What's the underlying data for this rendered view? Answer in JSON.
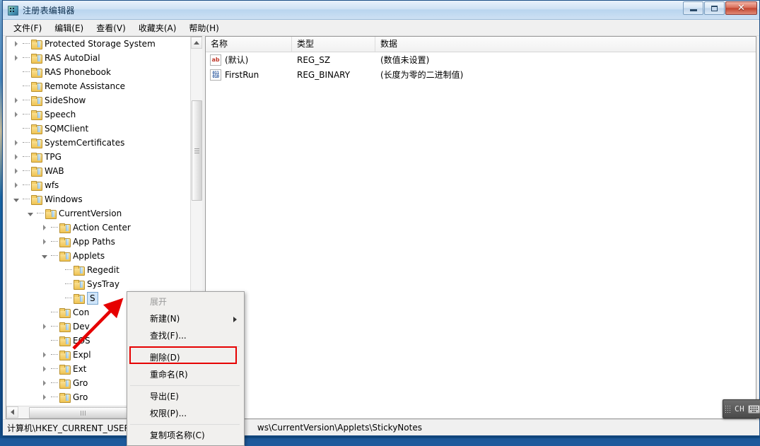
{
  "window": {
    "title": "注册表编辑器",
    "app_icon": "registry-editor-icon",
    "controls": {
      "minimize": "最小化",
      "maximize": "最大化",
      "close": "关闭"
    }
  },
  "menubar": [
    {
      "label": "文件(F)",
      "key": "F"
    },
    {
      "label": "编辑(E)",
      "key": "E"
    },
    {
      "label": "查看(V)",
      "key": "V"
    },
    {
      "label": "收藏夹(A)",
      "key": "A"
    },
    {
      "label": "帮助(H)",
      "key": "H"
    }
  ],
  "tree": [
    {
      "label": "Protected Storage System",
      "indent": 4,
      "expandable": true,
      "expanded": false,
      "selected": false,
      "clipped": true
    },
    {
      "label": "RAS AutoDial",
      "indent": 4,
      "expandable": true,
      "expanded": false,
      "selected": false
    },
    {
      "label": "RAS Phonebook",
      "indent": 4,
      "expandable": false,
      "expanded": false,
      "selected": false
    },
    {
      "label": "Remote Assistance",
      "indent": 4,
      "expandable": false,
      "expanded": false,
      "selected": false
    },
    {
      "label": "SideShow",
      "indent": 4,
      "expandable": true,
      "expanded": false,
      "selected": false
    },
    {
      "label": "Speech",
      "indent": 4,
      "expandable": true,
      "expanded": false,
      "selected": false
    },
    {
      "label": "SQMClient",
      "indent": 4,
      "expandable": false,
      "expanded": false,
      "selected": false
    },
    {
      "label": "SystemCertificates",
      "indent": 4,
      "expandable": true,
      "expanded": false,
      "selected": false
    },
    {
      "label": "TPG",
      "indent": 4,
      "expandable": true,
      "expanded": false,
      "selected": false
    },
    {
      "label": "WAB",
      "indent": 4,
      "expandable": true,
      "expanded": false,
      "selected": false
    },
    {
      "label": "wfs",
      "indent": 4,
      "expandable": true,
      "expanded": false,
      "selected": false
    },
    {
      "label": "Windows",
      "indent": 4,
      "expandable": true,
      "expanded": true,
      "selected": false
    },
    {
      "label": "CurrentVersion",
      "indent": 5,
      "expandable": true,
      "expanded": true,
      "selected": false
    },
    {
      "label": "Action Center",
      "indent": 6,
      "expandable": true,
      "expanded": false,
      "selected": false
    },
    {
      "label": "App Paths",
      "indent": 6,
      "expandable": true,
      "expanded": false,
      "selected": false
    },
    {
      "label": "Applets",
      "indent": 6,
      "expandable": true,
      "expanded": true,
      "selected": false
    },
    {
      "label": "Regedit",
      "indent": 7,
      "expandable": false,
      "expanded": false,
      "selected": false
    },
    {
      "label": "SysTray",
      "indent": 7,
      "expandable": false,
      "expanded": false,
      "selected": false
    },
    {
      "label": "S",
      "indent": 7,
      "expandable": false,
      "expanded": false,
      "selected": true
    },
    {
      "label": "Con",
      "indent": 6,
      "expandable": false,
      "expanded": false,
      "selected": false
    },
    {
      "label": "Dev",
      "indent": 6,
      "expandable": true,
      "expanded": false,
      "selected": false
    },
    {
      "label": "EOS",
      "indent": 6,
      "expandable": false,
      "expanded": false,
      "selected": false
    },
    {
      "label": "Expl",
      "indent": 6,
      "expandable": true,
      "expanded": false,
      "selected": false
    },
    {
      "label": "Ext",
      "indent": 6,
      "expandable": true,
      "expanded": false,
      "selected": false
    },
    {
      "label": "Gro",
      "indent": 6,
      "expandable": true,
      "expanded": false,
      "selected": false
    },
    {
      "label": "Gro",
      "indent": 6,
      "expandable": true,
      "expanded": false,
      "selected": false
    }
  ],
  "list": {
    "columns": [
      "名称",
      "类型",
      "数据"
    ],
    "rows": [
      {
        "icon": "string-value-icon",
        "name": "(默认)",
        "type": "REG_SZ",
        "data": "(数值未设置)"
      },
      {
        "icon": "binary-value-icon",
        "name": "FirstRun",
        "type": "REG_BINARY",
        "data": "(长度为零的二进制值)"
      }
    ]
  },
  "context_menu": {
    "items": [
      {
        "label": "展开",
        "disabled": true,
        "submenu": false,
        "separator_after": false
      },
      {
        "label": "新建(N)",
        "disabled": false,
        "submenu": true,
        "separator_after": false
      },
      {
        "label": "查找(F)...",
        "disabled": false,
        "submenu": false,
        "separator_after": true
      },
      {
        "label": "删除(D)",
        "disabled": false,
        "submenu": false,
        "separator_after": false,
        "highlighted": true
      },
      {
        "label": "重命名(R)",
        "disabled": false,
        "submenu": false,
        "separator_after": true
      },
      {
        "label": "导出(E)",
        "disabled": false,
        "submenu": false,
        "separator_after": false
      },
      {
        "label": "权限(P)...",
        "disabled": false,
        "submenu": false,
        "separator_after": true
      },
      {
        "label": "复制项名称(C)",
        "disabled": false,
        "submenu": false,
        "separator_after": false
      }
    ],
    "highlight_color": "#e60000"
  },
  "statusbar": {
    "path_left": "计算机\\HKEY_CURRENT_USER",
    "path_right": "ws\\CurrentVersion\\Applets\\StickyNotes"
  },
  "annotation": {
    "arrow_color": "#e60000",
    "arrow_target": "stickynotes-tree-node"
  },
  "ime": {
    "language": "CH",
    "grip": "drag-grip-icon",
    "keyboard": "keyboard-icon"
  }
}
